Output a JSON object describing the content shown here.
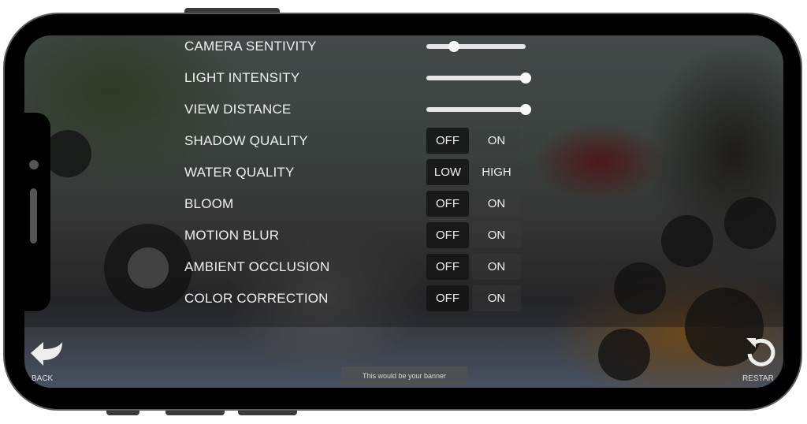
{
  "settings": {
    "sliders": [
      {
        "label": "CAMERA SENTIVITY",
        "value": 0.28
      },
      {
        "label": "LIGHT INTENSITY",
        "value": 1.0
      },
      {
        "label": "VIEW DISTANCE",
        "value": 1.0
      }
    ],
    "toggles": [
      {
        "label": "SHADOW QUALITY",
        "option_a": "OFF",
        "option_b": "ON",
        "selected": "a"
      },
      {
        "label": "WATER QUALITY",
        "option_a": "LOW",
        "option_b": "HIGH",
        "selected": "a"
      },
      {
        "label": "BLOOM",
        "option_a": "OFF",
        "option_b": "ON",
        "selected": "a"
      },
      {
        "label": "MOTION BLUR",
        "option_a": "OFF",
        "option_b": "ON",
        "selected": "a"
      },
      {
        "label": "AMBIENT OCCLUSION",
        "option_a": "OFF",
        "option_b": "ON",
        "selected": "a"
      },
      {
        "label": "COLOR CORRECTION",
        "option_a": "OFF",
        "option_b": "ON",
        "selected": "a"
      }
    ]
  },
  "nav": {
    "back_label": "BACK",
    "back_icon": "curved-arrow-left-icon",
    "restart_label": "RESTAR",
    "restart_icon": "restart-icon"
  },
  "banner": {
    "text": "This would be your banner"
  },
  "colors": {
    "text": "#f0f0f0",
    "selected_option_bg": "#141414",
    "slider_track": "#e6e6e6"
  }
}
